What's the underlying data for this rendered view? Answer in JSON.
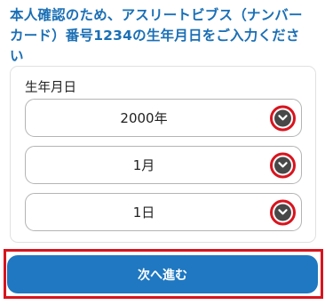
{
  "instruction": {
    "line1": "本人確認のため、アスリートビブス（ナンバー",
    "line2": "カード）番号1234の生年月日をご入力くださ",
    "line3": "い"
  },
  "birthdate": {
    "label": "生年月日",
    "year": {
      "value": "2000年"
    },
    "month": {
      "value": "1月"
    },
    "day": {
      "value": "1日"
    }
  },
  "next_button": {
    "label": "次へ進む"
  },
  "colors": {
    "accent_blue": "#1a6fb5",
    "button_blue": "#1f78c1",
    "highlight_red": "#d8141e",
    "icon_dark": "#484848"
  }
}
